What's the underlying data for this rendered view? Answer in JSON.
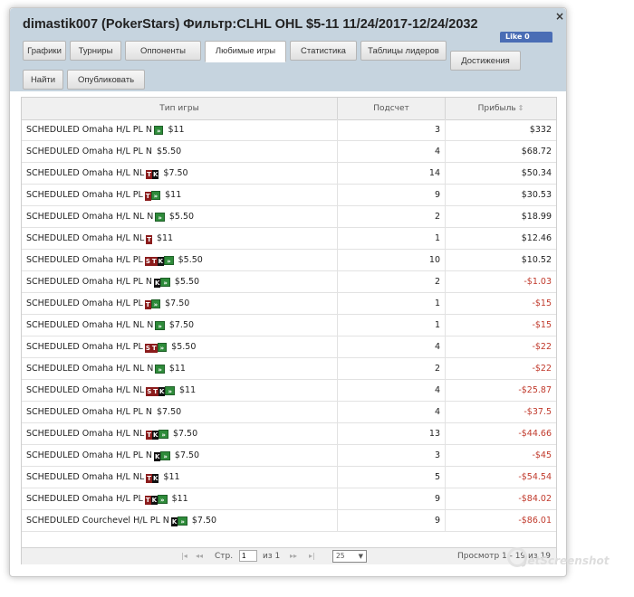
{
  "window": {
    "title": "dimastik007 (PokerStars) Фильтр:CLHL OHL $5-11 11/24/2017-12/24/2032",
    "close_label": "×",
    "like_label": "Like 0"
  },
  "tabs": [
    {
      "label": "Графики"
    },
    {
      "label": "Турниры"
    },
    {
      "label": "Оппоненты"
    },
    {
      "label": "Любимые игры",
      "active": true
    },
    {
      "label": "Статистика"
    },
    {
      "label": "Таблицы лидеров"
    },
    {
      "label": "Достижения"
    },
    {
      "label": "Найти"
    },
    {
      "label": "Опубликовать"
    }
  ],
  "table": {
    "columns": [
      "Тип игры",
      "Подсчет",
      "Прибыль"
    ],
    "rows": [
      {
        "name": "SCHEDULED Omaha H/L PL N",
        "badge": [
          "turbo"
        ],
        "buyin": "$11",
        "count": "3",
        "profit": "$332",
        "negative": false
      },
      {
        "name": "SCHEDULED Omaha H/L PL N",
        "badge": [],
        "buyin": "$5.50",
        "count": "4",
        "profit": "$68.72",
        "negative": false
      },
      {
        "name": "SCHEDULED Omaha H/L NL",
        "badge": [
          "T",
          "K"
        ],
        "buyin": "$7.50",
        "count": "14",
        "profit": "$50.34",
        "negative": false
      },
      {
        "name": "SCHEDULED Omaha H/L PL",
        "badge": [
          "T",
          "turbo"
        ],
        "buyin": "$11",
        "count": "9",
        "profit": "$30.53",
        "negative": false
      },
      {
        "name": "SCHEDULED Omaha H/L NL N",
        "badge": [
          "turbo"
        ],
        "buyin": "$5.50",
        "count": "2",
        "profit": "$18.99",
        "negative": false
      },
      {
        "name": "SCHEDULED Omaha H/L NL",
        "badge": [
          "T"
        ],
        "buyin": "$11",
        "count": "1",
        "profit": "$12.46",
        "negative": false
      },
      {
        "name": "SCHEDULED Omaha H/L PL",
        "badge": [
          "S",
          "T",
          "K",
          "turbo"
        ],
        "buyin": "$5.50",
        "count": "10",
        "profit": "$10.52",
        "negative": false
      },
      {
        "name": "SCHEDULED Omaha H/L PL N",
        "badge": [
          "K",
          "turbo"
        ],
        "buyin": "$5.50",
        "count": "2",
        "profit": "-$1.03",
        "negative": true
      },
      {
        "name": "SCHEDULED Omaha H/L PL",
        "badge": [
          "T",
          "turbo"
        ],
        "buyin": "$7.50",
        "count": "1",
        "profit": "-$15",
        "negative": true
      },
      {
        "name": "SCHEDULED Omaha H/L NL N",
        "badge": [
          "turbo"
        ],
        "buyin": "$7.50",
        "count": "1",
        "profit": "-$15",
        "negative": true
      },
      {
        "name": "SCHEDULED Omaha H/L PL",
        "badge": [
          "S",
          "T",
          "turbo"
        ],
        "buyin": "$5.50",
        "count": "4",
        "profit": "-$22",
        "negative": true
      },
      {
        "name": "SCHEDULED Omaha H/L NL N",
        "badge": [
          "turbo"
        ],
        "buyin": "$11",
        "count": "2",
        "profit": "-$22",
        "negative": true
      },
      {
        "name": "SCHEDULED Omaha H/L NL",
        "badge": [
          "S",
          "T",
          "K",
          "turbo"
        ],
        "buyin": "$11",
        "count": "4",
        "profit": "-$25.87",
        "negative": true
      },
      {
        "name": "SCHEDULED Omaha H/L PL N",
        "badge": [],
        "buyin": "$7.50",
        "count": "4",
        "profit": "-$37.5",
        "negative": true
      },
      {
        "name": "SCHEDULED Omaha H/L NL",
        "badge": [
          "T",
          "K",
          "turbo"
        ],
        "buyin": "$7.50",
        "count": "13",
        "profit": "-$44.66",
        "negative": true
      },
      {
        "name": "SCHEDULED Omaha H/L PL N",
        "badge": [
          "K",
          "turbo"
        ],
        "buyin": "$7.50",
        "count": "3",
        "profit": "-$45",
        "negative": true
      },
      {
        "name": "SCHEDULED Omaha H/L NL",
        "badge": [
          "T",
          "K"
        ],
        "buyin": "$11",
        "count": "5",
        "profit": "-$54.54",
        "negative": true
      },
      {
        "name": "SCHEDULED Omaha H/L PL",
        "badge": [
          "T",
          "K",
          "turbo"
        ],
        "buyin": "$11",
        "count": "9",
        "profit": "-$84.02",
        "negative": true
      },
      {
        "name": "SCHEDULED Courchevel H/L PL N",
        "badge": [
          "K",
          "turbo"
        ],
        "buyin": "$7.50",
        "count": "9",
        "profit": "-$86.01",
        "negative": true
      }
    ]
  },
  "pager": {
    "page_label": "Стр.",
    "page_value": "1",
    "of_label": "из 1",
    "page_size": "25",
    "summary": "Просмотр 1 - 19 из 19"
  },
  "watermark": "JetScreenshot"
}
